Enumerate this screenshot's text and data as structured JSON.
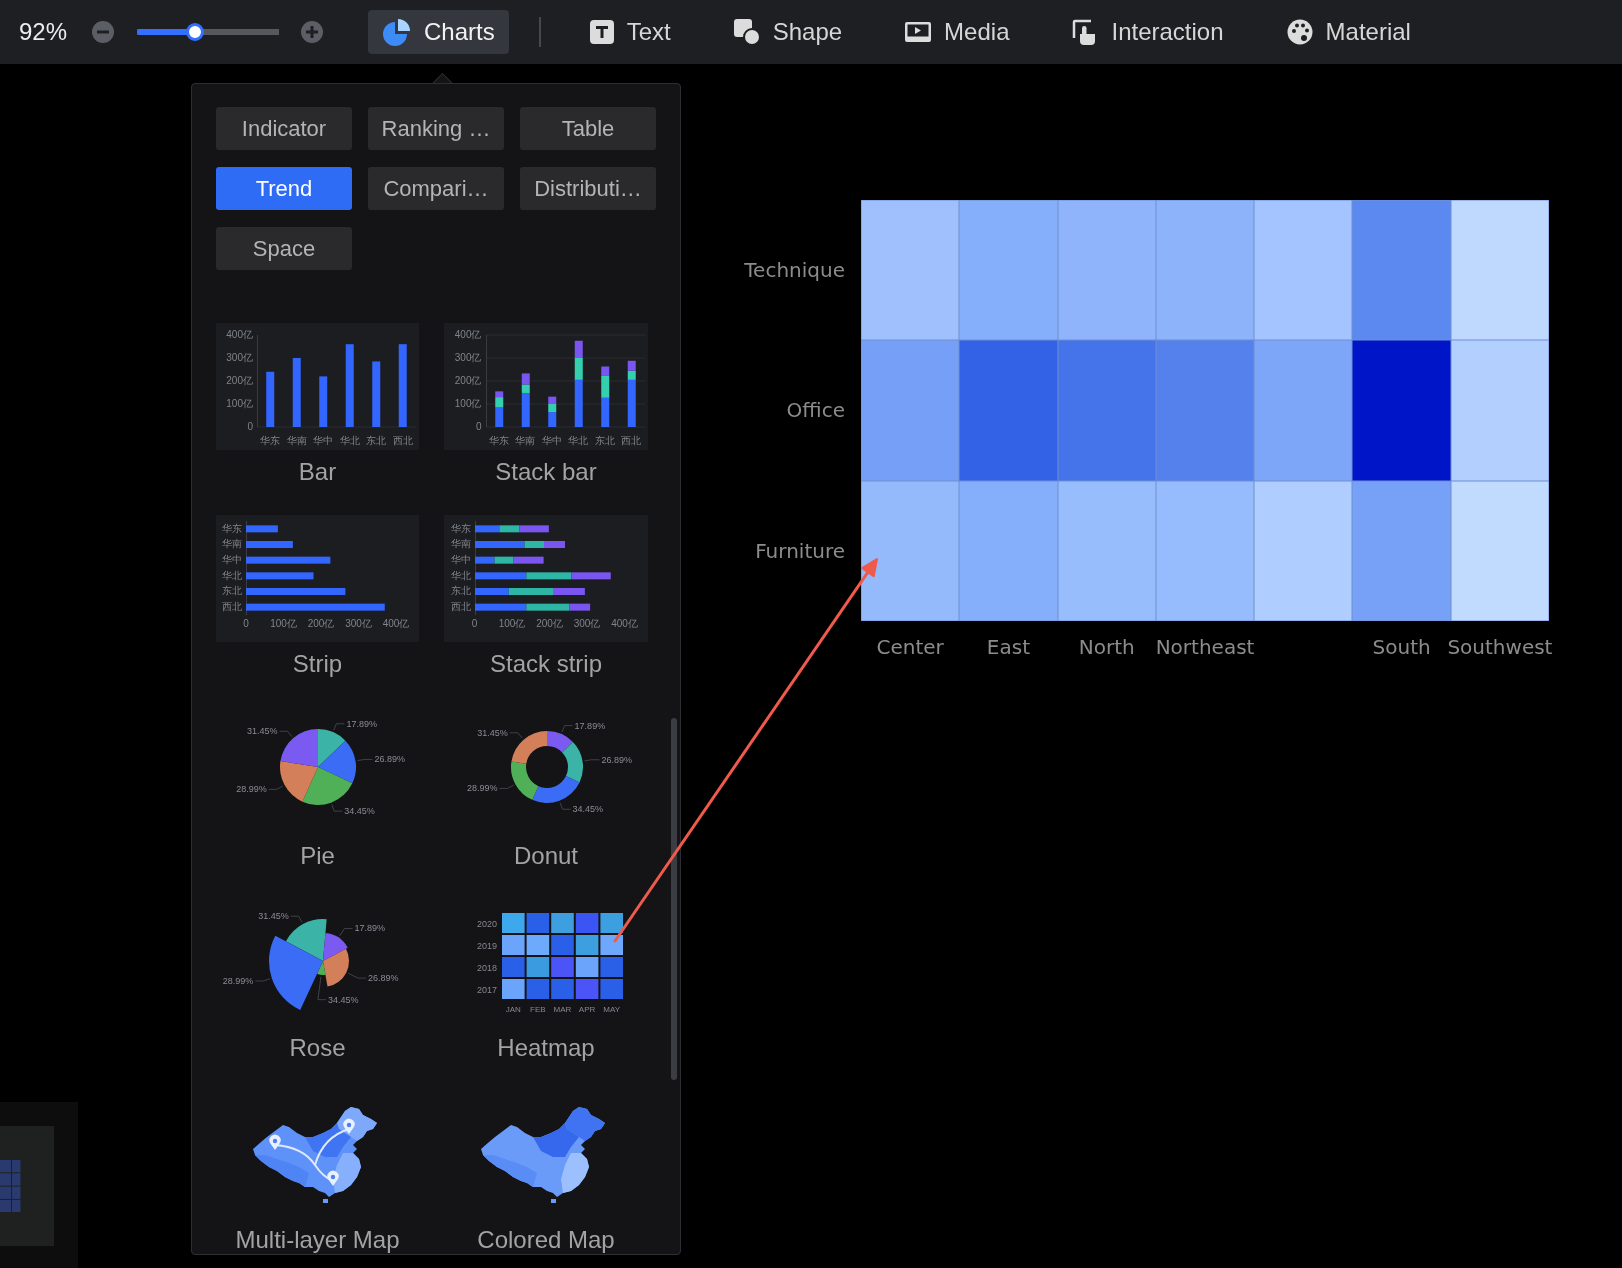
{
  "toolbar": {
    "zoom_value": "92%",
    "zoom_slider": {
      "level": 0.41
    },
    "tabs": [
      {
        "label": "Charts",
        "selected": true
      },
      {
        "label": "Text",
        "selected": false
      },
      {
        "label": "Shape",
        "selected": false
      },
      {
        "label": "Media",
        "selected": false
      },
      {
        "label": "Interaction",
        "selected": false
      },
      {
        "label": "Material",
        "selected": false
      }
    ]
  },
  "chart_menu": {
    "categories": [
      {
        "label": "Indicator",
        "selected": false
      },
      {
        "label": "Ranking …",
        "selected": false
      },
      {
        "label": "Table",
        "selected": false
      },
      {
        "label": "Trend",
        "selected": true
      },
      {
        "label": "Compari…",
        "selected": false
      },
      {
        "label": "Distributi…",
        "selected": false
      },
      {
        "label": "Space",
        "selected": false
      }
    ],
    "charts": [
      {
        "kind": "bar",
        "label": "Bar",
        "chart_data": {
          "type": "bar",
          "orientation": "vertical",
          "categories": [
            "华东",
            "华南",
            "华中",
            "华北",
            "东北",
            "西北"
          ],
          "values": [
            240,
            300,
            220,
            360,
            285,
            360
          ],
          "ylim": [
            0,
            400
          ],
          "yticks": [
            0,
            {
              "value": 100,
              "label": "100亿"
            },
            {
              "value": 200,
              "label": "200亿"
            },
            {
              "value": 300,
              "label": "300亿"
            },
            {
              "value": 400,
              "label": "400亿"
            }
          ]
        }
      },
      {
        "kind": "bar",
        "label": "Stack bar",
        "chart_data": {
          "type": "bar",
          "orientation": "vertical",
          "stacked": true,
          "grid": true,
          "categories": [
            "华东",
            "华南",
            "华中",
            "华北",
            "东北",
            "西北"
          ],
          "series": [
            {
              "color": "#3366ff",
              "values": [
                85,
                148,
                65,
                205,
                127,
                205
              ]
            },
            {
              "color": "#33cfae",
              "values": [
                45,
                37,
                35,
                95,
                95,
                40
              ]
            },
            {
              "color": "#7a55f0",
              "values": [
                25,
                48,
                32,
                75,
                41,
                43
              ]
            }
          ],
          "ylim": [
            0,
            400
          ],
          "yticks": [
            0,
            {
              "value": 100,
              "label": "100亿"
            },
            {
              "value": 200,
              "label": "200亿"
            },
            {
              "value": 300,
              "label": "300亿"
            },
            {
              "value": 400,
              "label": "400亿"
            }
          ]
        }
      },
      {
        "kind": "bar",
        "label": "Strip",
        "chart_data": {
          "type": "bar",
          "orientation": "horizontal",
          "categories": [
            "华东",
            "华南",
            "华中",
            "华北",
            "东北",
            "西北"
          ],
          "values": [
            85,
            125,
            225,
            180,
            265,
            370
          ],
          "xlim": [
            0,
            400
          ],
          "xticks": [
            0,
            {
              "value": 100,
              "label": "100亿"
            },
            {
              "value": 200,
              "label": "200亿"
            },
            {
              "value": 300,
              "label": "300亿"
            },
            {
              "value": 400,
              "label": "400亿"
            }
          ]
        }
      },
      {
        "kind": "bar",
        "label": "Stack strip",
        "chart_data": {
          "type": "bar",
          "orientation": "horizontal",
          "stacked": true,
          "categories": [
            "华东",
            "华南",
            "华中",
            "华北",
            "东北",
            "西北"
          ],
          "series": [
            {
              "color": "#3366ff",
              "values": [
                65,
                132,
                52,
                137,
                90,
                137
              ]
            },
            {
              "color": "#2db5a5",
              "values": [
                53,
                52,
                51,
                120,
                118,
                115
              ]
            },
            {
              "color": "#7a55f0",
              "values": [
                79,
                56,
                80,
                105,
                85,
                55
              ]
            }
          ],
          "xlim": [
            0,
            400
          ],
          "xticks": [
            0,
            {
              "value": 100,
              "label": "100亿"
            },
            {
              "value": 200,
              "label": "200亿"
            },
            {
              "value": 300,
              "label": "300亿"
            },
            {
              "value": 400,
              "label": "400亿"
            }
          ]
        }
      },
      {
        "kind": "pie",
        "label": "Pie",
        "chart_data": {
          "type": "pie",
          "values": [
            17.89,
            26.89,
            34.45,
            28.99,
            31.45
          ],
          "colors": [
            "#3bb3a6",
            "#3a6cf6",
            "#4fb058",
            "#d3805a",
            "#7a5af0"
          ],
          "value_labels": [
            "17.89%",
            "26.89%",
            "34.45%",
            "28.99%",
            "31.45%"
          ]
        }
      },
      {
        "kind": "pie",
        "label": "Donut",
        "chart_data": {
          "type": "donut",
          "values": [
            17.89,
            26.89,
            34.45,
            28.99,
            31.45
          ],
          "colors": [
            "#7a5af0",
            "#3bb3a6",
            "#3a6cf6",
            "#4fb058",
            "#d3805a"
          ],
          "value_labels": [
            "17.89%",
            "26.89%",
            "34.45%",
            "28.99%",
            "31.45%"
          ]
        }
      },
      {
        "kind": "rose",
        "label": "Rose",
        "slices": [
          {
            "label": "31.45%",
            "color": "#3bb3a6"
          },
          {
            "label": "17.89%",
            "color": "#7a5af0"
          },
          {
            "label": "26.89%",
            "color": "#d3805a"
          },
          {
            "label": "34.45%",
            "color": "#4fb058"
          },
          {
            "label": "28.99%",
            "color": "#3a6cf6"
          }
        ]
      },
      {
        "kind": "heatmap",
        "label": "Heatmap",
        "heatmap": {
          "rows": [
            {
              "label": "2020",
              "cells": [
                {
                  "color": "#3ea8ec"
                },
                {
                  "color": "#2a5fe8"
                },
                {
                  "color": "#3d9ee0"
                },
                {
                  "color": "#3b55f5"
                },
                {
                  "color": "#3b9fe0"
                }
              ]
            },
            {
              "label": "2019",
              "cells": [
                {
                  "color": "#6ba4fb"
                },
                {
                  "color": "#6eaafc"
                },
                {
                  "color": "#2a5fe8"
                },
                {
                  "color": "#3d9ee0"
                },
                {
                  "color": "#6ea8fc"
                }
              ]
            },
            {
              "label": "2018",
              "cells": [
                {
                  "color": "#2a5fe8"
                },
                {
                  "color": "#3a9be0"
                },
                {
                  "color": "#4b55f7"
                },
                {
                  "color": "#6ba4fb"
                },
                {
                  "color": "#2a5fe8"
                }
              ]
            },
            {
              "label": "2017",
              "cells": [
                {
                  "color": "#6ba4fb"
                },
                {
                  "color": "#2a5fe8"
                },
                {
                  "color": "#2a5fe8"
                },
                {
                  "color": "#4b55f7"
                },
                {
                  "color": "#2a5fe8"
                }
              ]
            }
          ],
          "columns": [
            {
              "label": "JAN"
            },
            {
              "label": "FEB"
            },
            {
              "label": "MAR"
            },
            {
              "label": "APR"
            },
            {
              "label": "MAY"
            }
          ]
        }
      },
      {
        "kind": "multi_layer_map",
        "label": "Multi-layer Map"
      },
      {
        "kind": "colored_map",
        "label": "Colored Map"
      }
    ]
  },
  "canvas": {
    "heatmap": {
      "rows": [
        {
          "label": "Technique",
          "cells": [
            {
              "color": "#9fc0fd"
            },
            {
              "color": "#85aefb"
            },
            {
              "color": "#8fb4fb"
            },
            {
              "color": "#8db3fb"
            },
            {
              "color": "#a3c4fe"
            },
            {
              "color": "#5b89f0"
            },
            {
              "color": "#bed8fe"
            }
          ]
        },
        {
          "label": "Office",
          "cells": [
            {
              "color": "#76a0f7"
            },
            {
              "color": "#3462e6"
            },
            {
              "color": "#4574ea"
            },
            {
              "color": "#5581ec"
            },
            {
              "color": "#7ea6f8"
            },
            {
              "color": "#0015c8"
            },
            {
              "color": "#b2cffe"
            }
          ]
        },
        {
          "label": "Furniture",
          "cells": [
            {
              "color": "#95bafc"
            },
            {
              "color": "#86affb"
            },
            {
              "color": "#98bdfd"
            },
            {
              "color": "#97bcfd"
            },
            {
              "color": "#afcdfe"
            },
            {
              "color": "#77a0f7"
            },
            {
              "color": "#c1dbfe"
            }
          ]
        }
      ],
      "columns": [
        {
          "label": "Center"
        },
        {
          "label": "East"
        },
        {
          "label": "North"
        },
        {
          "label": "Northeast"
        },
        {},
        {
          "label": "South"
        },
        {
          "label": "Southwest"
        }
      ]
    }
  }
}
